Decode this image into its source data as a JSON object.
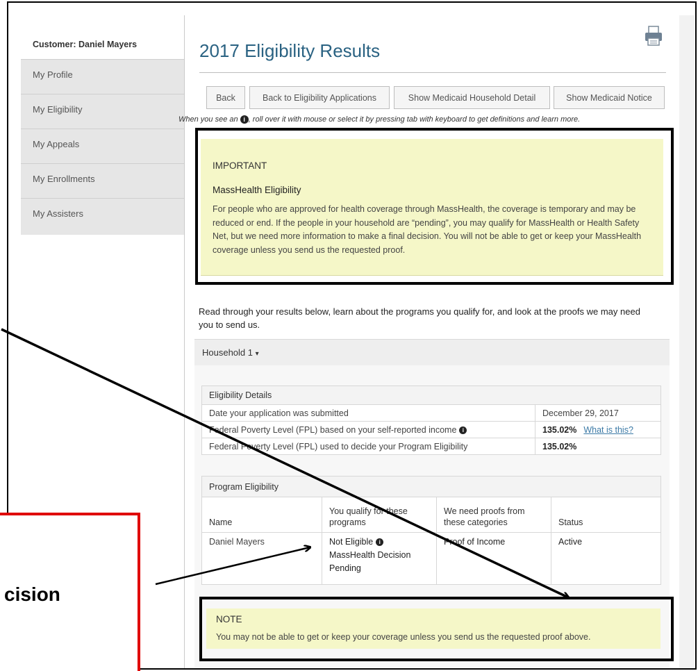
{
  "sidebar": {
    "customer_label": "Customer: Daniel Mayers",
    "items": [
      {
        "label": "My Profile"
      },
      {
        "label": "My Eligibility"
      },
      {
        "label": "My Appeals"
      },
      {
        "label": "My Enrollments"
      },
      {
        "label": "My Assisters"
      }
    ]
  },
  "page": {
    "title": "2017 Eligibility Results",
    "icons": {
      "print": "printer-icon",
      "info": "info-icon"
    }
  },
  "buttons": {
    "back": "Back",
    "back_to_apps": "Back to Eligibility Applications",
    "household_detail": "Show Medicaid Household Detail",
    "notice": "Show Medicaid Notice"
  },
  "hint": {
    "before": "When you see an",
    "after": ", roll over it with mouse or select it by pressing tab with keyboard to get definitions and learn more."
  },
  "important": {
    "heading": "IMPORTANT",
    "subheading": "MassHealth Eligibility",
    "body": "For people who are approved for health coverage through MassHealth, the coverage is temporary and may be reduced or end. If the people in your household are “pending”, you may qualify for MassHealth or Health Safety Net, but we need more information to make a final decision. You will not be able to get or keep your MassHealth coverage unless you send us the requested proof."
  },
  "intro_text": "Read through your results below, learn about the programs you qualify for, and look at the proofs we may need you to send us.",
  "household": {
    "label": "Household 1",
    "caret": "▾"
  },
  "eligibility_details": {
    "caption": "Eligibility Details",
    "rows": [
      {
        "label": "Date your application was submitted",
        "value": "December 29, 2017",
        "link": ""
      },
      {
        "label": "Federal Poverty Level (FPL) based on your self-reported income",
        "value": "135.02%",
        "link": "What is this?"
      },
      {
        "label": "Federal Poverty Level (FPL) used to decide your Program Eligibility",
        "value": "135.02%",
        "link": ""
      }
    ]
  },
  "program_eligibility": {
    "caption": "Program Eligibility",
    "headers": [
      "Name",
      "You qualify for these programs",
      "We need proofs from these categories",
      "Status"
    ],
    "row": {
      "name": "Daniel Mayers",
      "qualify_line1": "Not Eligible",
      "qualify_line2": "MassHealth Decision Pending",
      "proofs": "Proof of Income",
      "status": "Active"
    }
  },
  "note": {
    "heading": "NOTE",
    "body": "You may not be able to get or keep your coverage unless you send us the requested proof above."
  },
  "callout": {
    "visible_text": "cision"
  },
  "colors": {
    "title_blue": "#2a6282",
    "highlight_yellow": "#f5f7c8",
    "callout_red": "#e00000",
    "link_blue": "#3c7aa6"
  }
}
